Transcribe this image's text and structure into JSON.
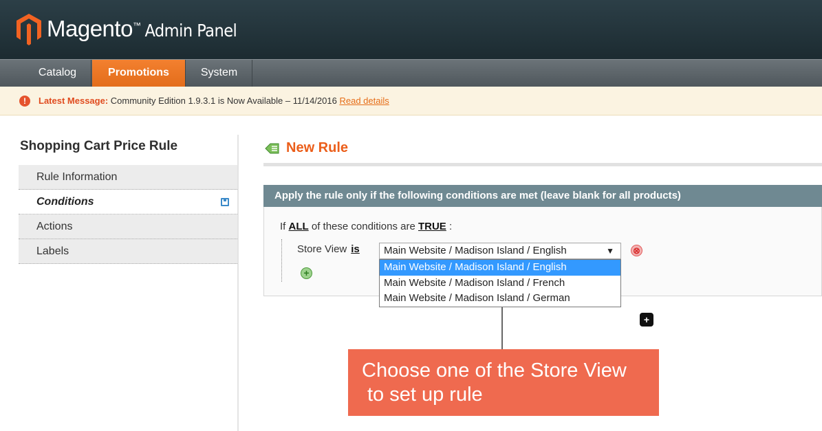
{
  "header": {
    "brand": "Magento",
    "tm": "™",
    "subtitle": "Admin Panel"
  },
  "nav": {
    "items": [
      {
        "label": "Catalog",
        "active": false
      },
      {
        "label": "Promotions",
        "active": true
      },
      {
        "label": "System",
        "active": false
      }
    ]
  },
  "message": {
    "icon": "!",
    "label": "Latest Message:",
    "text": "Community Edition 1.9.3.1 is Now Available – 11/14/2016",
    "link": "Read details"
  },
  "sidebar": {
    "title": "Shopping Cart Price Rule",
    "items": [
      {
        "label": "Rule Information",
        "active": false
      },
      {
        "label": "Conditions",
        "active": true
      },
      {
        "label": "Actions",
        "active": false
      },
      {
        "label": "Labels",
        "active": false
      }
    ],
    "save_icon": "save-icon"
  },
  "main": {
    "title": "New Rule",
    "fieldset_title": "Apply the rule only if the following conditions are met (leave blank for all products)",
    "condition": {
      "prefix": "If",
      "aggregator": "ALL",
      "middle": "of these conditions are",
      "value": "TRUE",
      "suffix": ":"
    },
    "row": {
      "attribute": "Store View",
      "operator": "is",
      "selected": "Main Website / Madison Island / English",
      "arrow": "▼",
      "remove_icon": "⊗",
      "add_icon": "+"
    },
    "options": [
      "Main Website / Madison Island / English",
      "Main Website / Madison Island / French",
      "Main Website / Madison Island / German"
    ]
  },
  "annotation": {
    "plus_badge": "+",
    "callout_line1": "Choose one of the Store View",
    "callout_line2": "to set up rule"
  },
  "colors": {
    "accent": "#eb5e1a",
    "nav_active": "#f3802f",
    "fieldset_header": "#6f8992",
    "callout": "#ef6a4f",
    "selected_option": "#3399ff"
  }
}
